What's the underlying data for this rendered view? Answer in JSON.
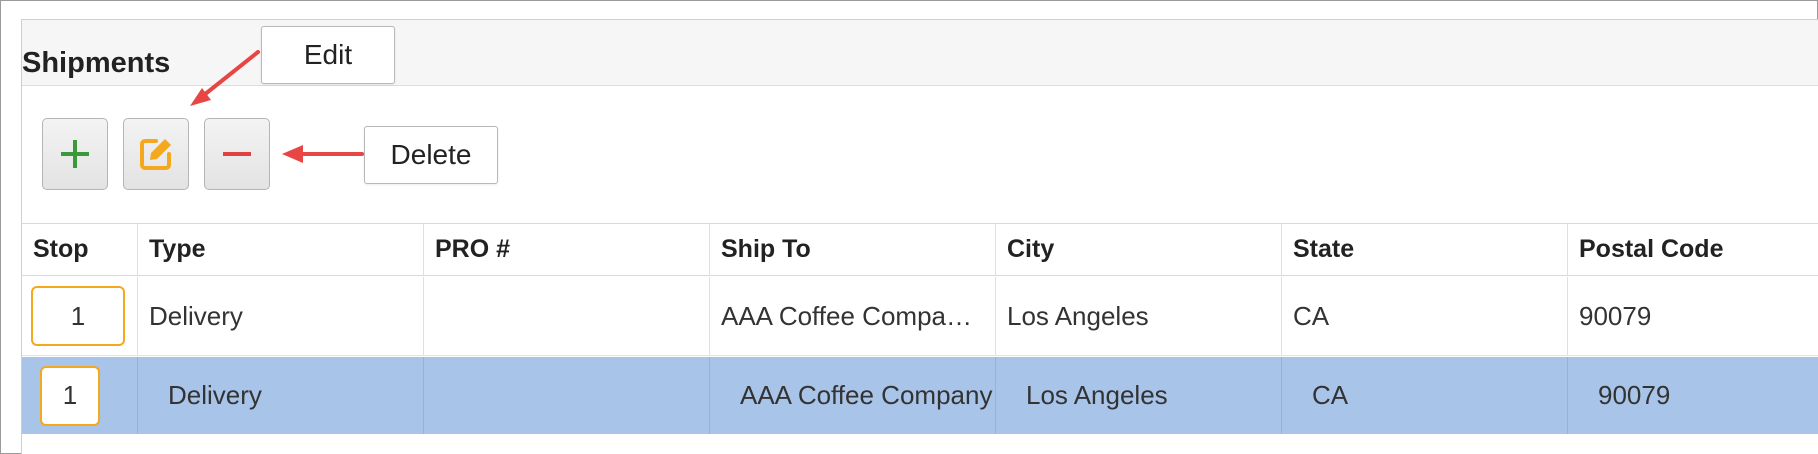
{
  "section": {
    "title": "Shipments"
  },
  "toolbar": {
    "add": {
      "icon": "plus-icon",
      "color": "#3a9a3a"
    },
    "edit": {
      "icon": "edit-icon",
      "color": "#f4a81d"
    },
    "delete": {
      "icon": "minus-icon",
      "color": "#e04040"
    }
  },
  "callouts": {
    "edit_label": "Edit",
    "delete_label": "Delete",
    "arrow_color": "#e84545"
  },
  "grid": {
    "columns": [
      "Stop",
      "Type",
      "PRO #",
      "Ship To",
      "City",
      "State",
      "Postal Code"
    ],
    "rows": [
      {
        "stop": "1",
        "type": "Delivery",
        "pro": "",
        "ship_to": "AAA Coffee Compa…",
        "city": "Los Angeles",
        "state": "CA",
        "postal": "90079",
        "selected": false
      },
      {
        "stop": "1",
        "type": "Delivery",
        "pro": "",
        "ship_to": "AAA Coffee Company",
        "city": "Los Angeles",
        "state": "CA",
        "postal": "90079",
        "selected": true
      }
    ],
    "selected_row_color": "#a8c4e8",
    "stop_border_color": "#f4a81d"
  }
}
